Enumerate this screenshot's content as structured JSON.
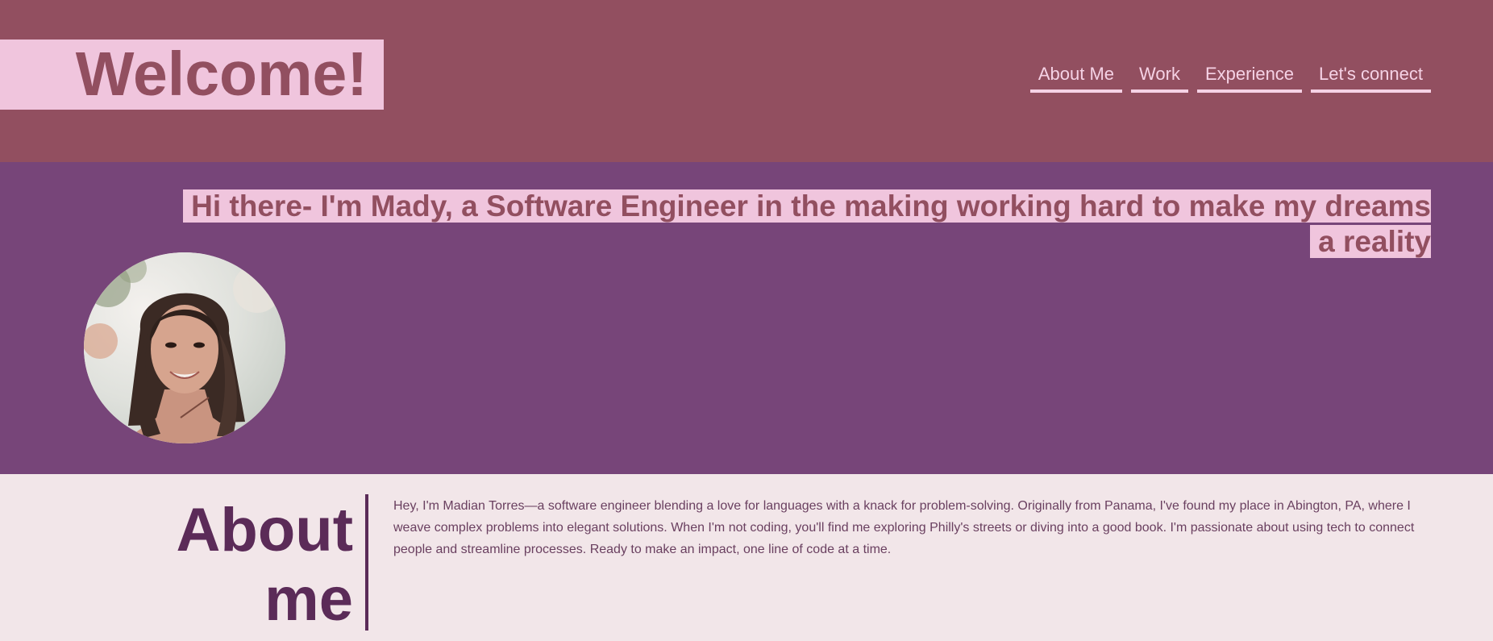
{
  "header": {
    "title": "Welcome!",
    "nav": [
      {
        "label": "About Me"
      },
      {
        "label": "Work"
      },
      {
        "label": "Experience"
      },
      {
        "label": "Let's connect"
      }
    ]
  },
  "hero": {
    "tagline": "Hi there- I'm Mady, a Software Engineer in the making working hard to make my dreams a reality",
    "avatar_icon": "profile-photo"
  },
  "about": {
    "heading": "About me",
    "body": "Hey, I'm Madian Torres—a software engineer blending a love for languages with a knack for problem-solving. Originally from Panama, I've found my place in Abington, PA, where I weave complex problems into elegant solutions. When I'm not coding, you'll find me exploring Philly's streets or diving into a good book. I'm passionate about using tech to connect people and streamline processes. Ready to make an impact, one line of code at a time."
  },
  "colors": {
    "header_bg": "#924f60",
    "hero_bg": "#774579",
    "highlight": "#f0c5dd",
    "about_bg": "#f2e6e9",
    "about_accent": "#5b2b58"
  }
}
